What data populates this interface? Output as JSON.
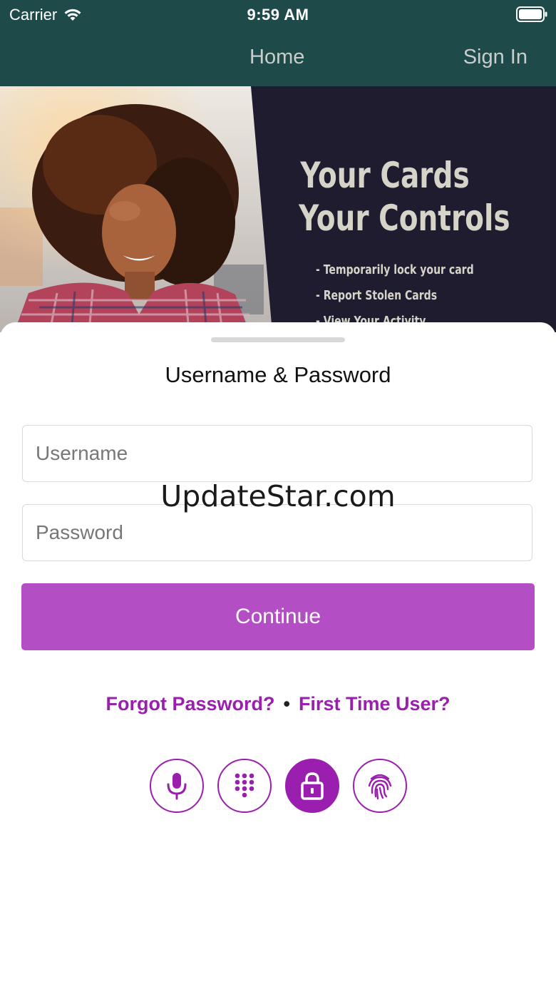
{
  "status_bar": {
    "carrier": "Carrier",
    "time": "9:59 AM"
  },
  "nav": {
    "home_label": "Home",
    "signin_label": "Sign In"
  },
  "hero": {
    "headline_line1": "Your Cards",
    "headline_line2": "Your Controls",
    "bullets": [
      "- Temporarily lock your card",
      "- Report Stolen Cards",
      "- View Your Activity"
    ]
  },
  "sheet": {
    "title": "Username & Password",
    "username_placeholder": "Username",
    "password_placeholder": "Password",
    "watermark": "UpdateStar.com",
    "continue_label": "Continue",
    "forgot_password_label": "Forgot Password?",
    "separator": "•",
    "first_time_user_label": "First Time User?"
  },
  "auth_methods": [
    "microphone-icon",
    "keypad-icon",
    "lock-icon",
    "fingerprint-icon"
  ],
  "colors": {
    "header": "#1e4a4a",
    "accent": "#b34ec4",
    "link": "#9b1fae",
    "hero_bg": "#1f1c30"
  }
}
